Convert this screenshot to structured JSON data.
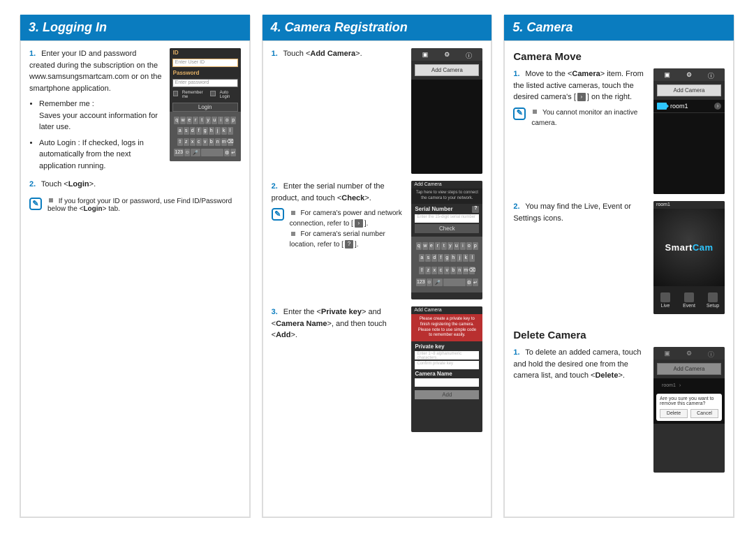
{
  "panel1": {
    "header": "3. Logging In",
    "step1": "Enter your ID and password created during the subscription on the www.samsungsmartcam.com or on the smartphone application.",
    "bullets": [
      {
        "t": "Remember me :",
        "d": "Saves your account information for later use."
      },
      {
        "t": "Auto Login : If checked, logs in automatically from the next application running.",
        "d": ""
      }
    ],
    "step2_pre": "Touch <",
    "step2_b": "Login",
    "step2_post": ">.",
    "note_a": "If you forgot your ID or password, use Find ID/Password below the <",
    "note_b": "Login",
    "note_c": "> tab.",
    "ss": {
      "id_label": "ID",
      "id_ph": "Enter User ID",
      "pw_label": "Password",
      "pw_ph": "Enter password",
      "remember": "Remember me",
      "auto": "Auto Login",
      "login_btn": "Login"
    }
  },
  "panel2": {
    "header": "4. Camera Registration",
    "step1_pre": "Touch <",
    "step1_b": "Add Camera",
    "step1_post": ">.",
    "step2_pre": "Enter the serial number of the product, and touch <",
    "step2_b": "Check",
    "step2_post": ">.",
    "note2a": "For camera's power and network connection, refer to [",
    "note2b": "].",
    "note2c": "For camera's serial number location, refer to [",
    "step3_a": "Enter the <",
    "step3_b": "Private key",
    "step3_c": "> and <",
    "step3_d": "Camera Name",
    "step3_e": ">, and then touch <",
    "step3_f": "Add",
    "step3_g": ">.",
    "ss_add": {
      "topbar": "Add Camera",
      "title": "Add Camera"
    },
    "ss_serial": {
      "title": "Add Camera",
      "msg": "Tap here to view steps to connect the camera to your network.",
      "label": "Serial Number",
      "ph": "Enter the 15-digit serial number",
      "btn": "Check"
    },
    "ss_pkey": {
      "title": "Add Camera",
      "red": "Please create a private key to finish registering the camera. Please note to use simple code to remember easily.",
      "pk_label": "Private key",
      "pk_ph1": "Enter 1~8 alphanumeric characters.",
      "pk_ph2": "Confirm private key",
      "cn_label": "Camera Name",
      "add": "Add"
    }
  },
  "panel3": {
    "header": "5. Camera",
    "sub1": "Camera Move",
    "s1_a": "Move to the <",
    "s1_b": "Camera",
    "s1_c": "> item. From the listed active cameras, touch the desired camera's [",
    "s1_d": "] on the right.",
    "note1": "You cannot monitor an inactive camera.",
    "s2": "You may find the Live, Event or Settings icons.",
    "sub2": "Delete Camera",
    "d1_a": "To delete an added camera, touch and hold the desired one from the camera list, and touch <",
    "d1_b": "Delete",
    "d1_c": ">.",
    "ss_list": {
      "add": "Add Camera",
      "room": "room1"
    },
    "ss_smart": {
      "logo_a": "Smart",
      "logo_b": "Cam",
      "live": "Live",
      "event": "Event",
      "setup": "Setup"
    },
    "ss_del": {
      "add": "Add Camera",
      "room": "room1",
      "modal": "Are you sure you want to remove this camera?",
      "del": "Delete",
      "cancel": "Cancel"
    }
  },
  "kbd": {
    "r1": [
      "q",
      "w",
      "e",
      "r",
      "t",
      "y",
      "u",
      "i",
      "o",
      "p"
    ],
    "r2": [
      "a",
      "s",
      "d",
      "f",
      "g",
      "h",
      "j",
      "k",
      "l"
    ],
    "r3": [
      "⇧",
      "z",
      "x",
      "c",
      "v",
      "b",
      "n",
      "m",
      "⌫"
    ],
    "r4": [
      "123",
      "☺",
      "🎤",
      "　",
      "⚙",
      "↵"
    ]
  }
}
